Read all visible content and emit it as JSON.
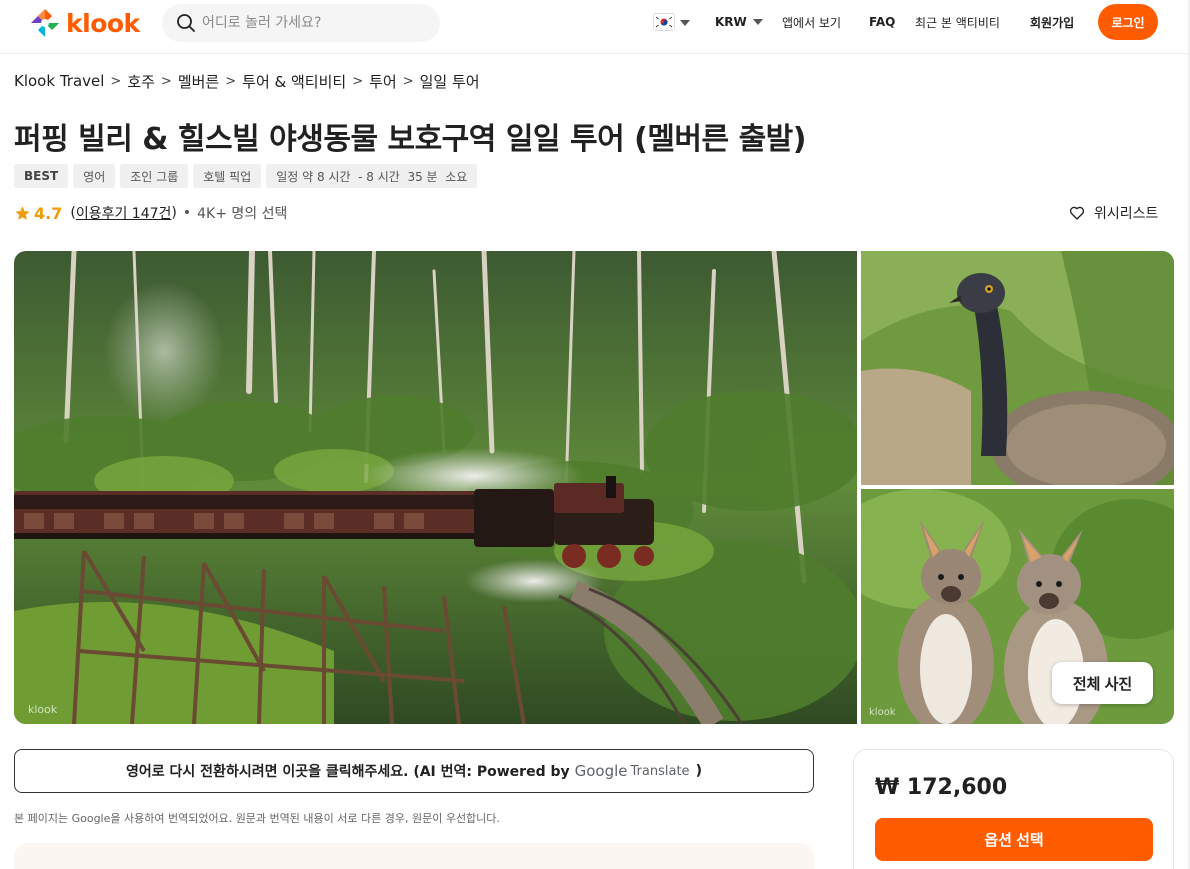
{
  "header": {
    "logo_text": "klook",
    "search_placeholder": "어디로 놀러 가세요?",
    "currency": "KRW",
    "app_link": "앱에서 보기",
    "faq": "FAQ",
    "recent": "최근 본 액티비티",
    "signup": "회원가입",
    "login": "로그인",
    "brand_color": "#ff5b00"
  },
  "breadcrumb": [
    "Klook Travel",
    "호주",
    "멜버른",
    "투어 & 액티비티",
    "투어",
    "일일 투어"
  ],
  "activity": {
    "title": "퍼핑 빌리 & 힐스빌 야생동물 보호구역 일일 투어 (멜버른 출발)",
    "tags": [
      "BEST",
      "영어",
      "조인 그룹",
      "호텔 픽업",
      "일정 약 8 시간  - 8 시간  35 분  소요"
    ],
    "rating": "4.7",
    "reviews": "이용후기 147건",
    "booked": "4K+ 명의 선택",
    "wishlist": "위시리스트"
  },
  "gallery": {
    "watermark": "klook",
    "all_photos": "전체 사진"
  },
  "translation": {
    "button_text": "영어로 다시 전환하시려면 이곳을 클릭해주세요. (AI 번역: Powered by",
    "google": "Google",
    "translate": "Translate",
    "close_paren": ")",
    "notice": "본 페이지는 Google을 사용하여 번역되었어요. 원문과 번역된 내용이 서로 다른 경우, 원문이 우선합니다."
  },
  "booking": {
    "price": "₩ 172,600",
    "select_button": "옵션 선택"
  }
}
